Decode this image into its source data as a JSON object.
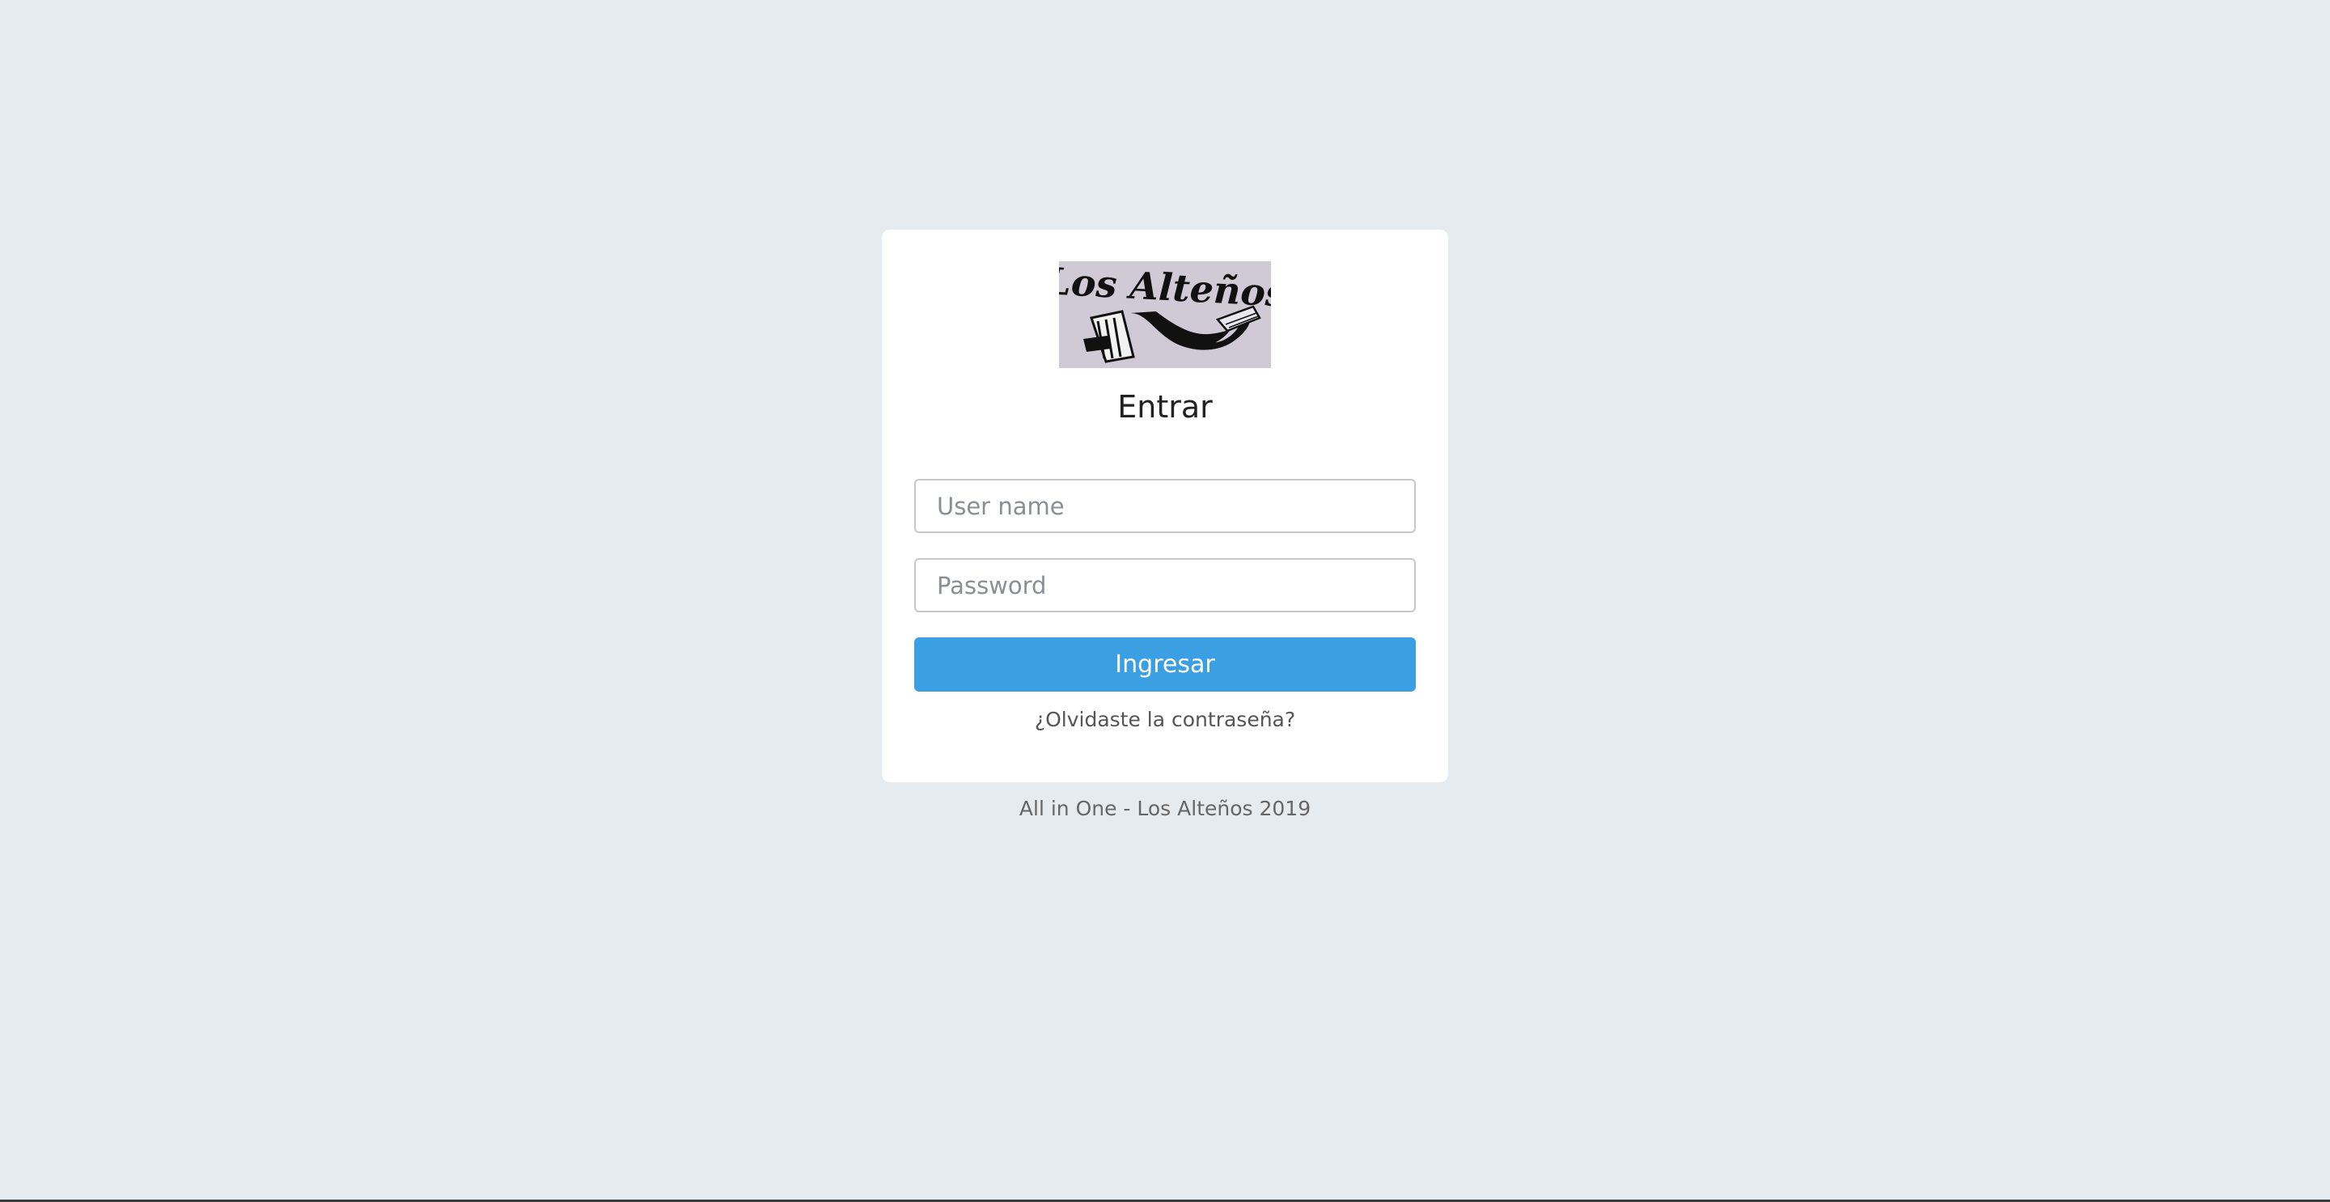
{
  "login": {
    "logo_text": "Los Alteños",
    "heading": "Entrar",
    "username_placeholder": "User name",
    "username_value": "",
    "password_placeholder": "Password",
    "password_value": "",
    "submit_label": "Ingresar",
    "forgot_link": "¿Olvidaste la contraseña?"
  },
  "footer": {
    "text": "All in One - Los Alteños 2019"
  },
  "colors": {
    "background": "#e6ebf0",
    "card": "#ffffff",
    "primary_button": "#3b9fe4"
  }
}
